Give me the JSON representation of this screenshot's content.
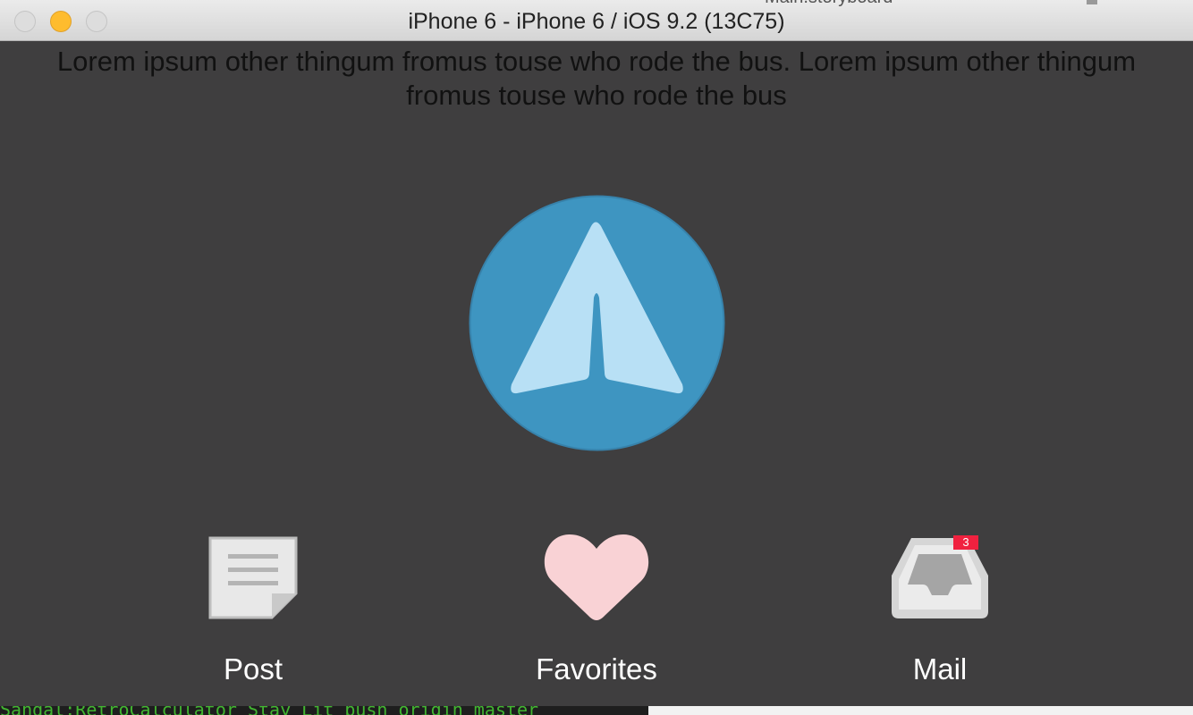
{
  "window": {
    "title": "iPhone 6 - iPhone 6 / iOS 9.2 (13C75)",
    "background_peek_text": "Main.storyboard"
  },
  "content": {
    "header_text": "Lorem ipsum other thingum fromus touse who rode the bus. Lorem ipsum other thingum fromus touse who rode the bus",
    "logo_icon": "paper-plane-icon"
  },
  "tabs": [
    {
      "label": "Post",
      "icon": "document-icon"
    },
    {
      "label": "Favorites",
      "icon": "heart-icon"
    },
    {
      "label": "Mail",
      "icon": "inbox-tray-icon",
      "badge": "3"
    }
  ],
  "terminal": {
    "text": "Sandal:RetroCalculator Stay Lit push origin master"
  },
  "colors": {
    "background": "#3f3e3f",
    "logo_circle": "#3e95c1",
    "logo_plane": "#b8e0f5",
    "heart": "#f9d2d5",
    "badge": "#f0213f",
    "terminal_green": "#42b531"
  }
}
